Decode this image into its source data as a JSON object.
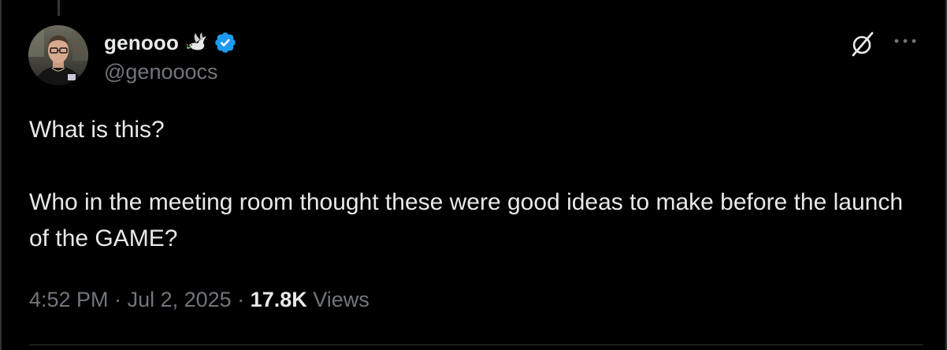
{
  "tweet": {
    "author": {
      "display_name": "genooo",
      "handle": "@genooocs",
      "badges": [
        "dove-emoji-icon",
        "verified-badge-icon"
      ]
    },
    "text_line_1": "What is this?",
    "text_paragraph_2": "Who in the meeting room thought these were good ideas to make before the launch of the GAME?",
    "meta": {
      "time": "4:52 PM",
      "separator_1": " · ",
      "date": "Jul 2, 2025",
      "separator_2": " · ",
      "views_count": "17.8K",
      "views_label": " Views"
    },
    "actions": {
      "grok_icon": "grok-icon",
      "more_icon": "more-options-icon"
    }
  },
  "colors": {
    "background": "#000000",
    "primary_text": "#e7e9ea",
    "secondary_text": "#71767b",
    "verified_blue": "#1d9bf0",
    "divider": "#2f3336"
  }
}
